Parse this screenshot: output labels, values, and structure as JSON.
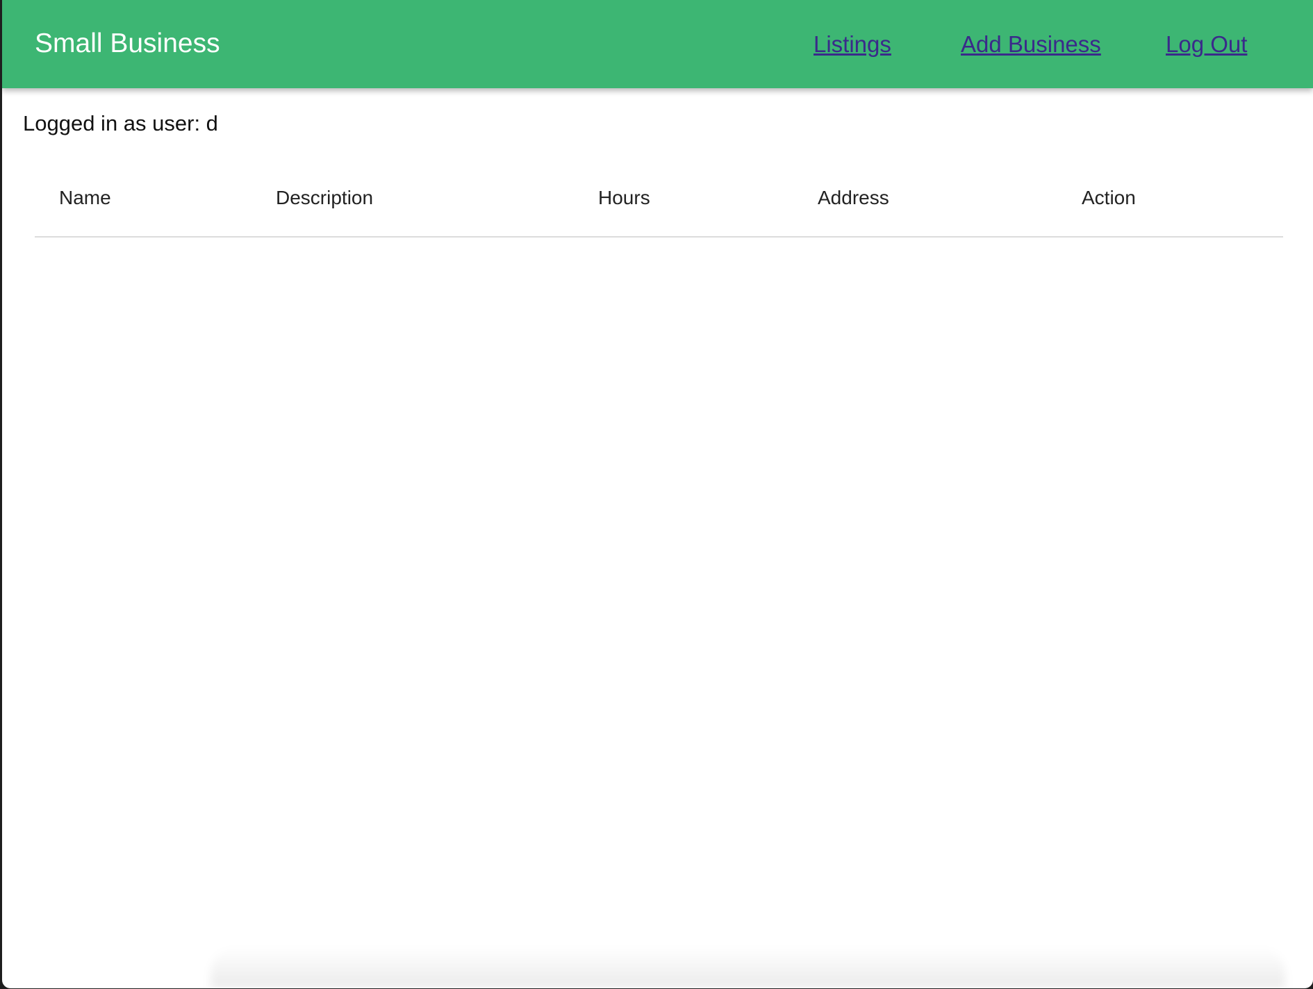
{
  "header": {
    "brand": "Small Business",
    "nav": [
      {
        "label": "Listings"
      },
      {
        "label": "Add Business"
      },
      {
        "label": "Log Out"
      }
    ],
    "colors": {
      "bar": "#3db673",
      "brand_text": "#ffffff",
      "link": "#3a2a8a"
    }
  },
  "main": {
    "user_status": "Logged in as user: d",
    "table": {
      "columns": [
        "Name",
        "Description",
        "Hours",
        "Address",
        "Action"
      ],
      "rows": []
    }
  }
}
